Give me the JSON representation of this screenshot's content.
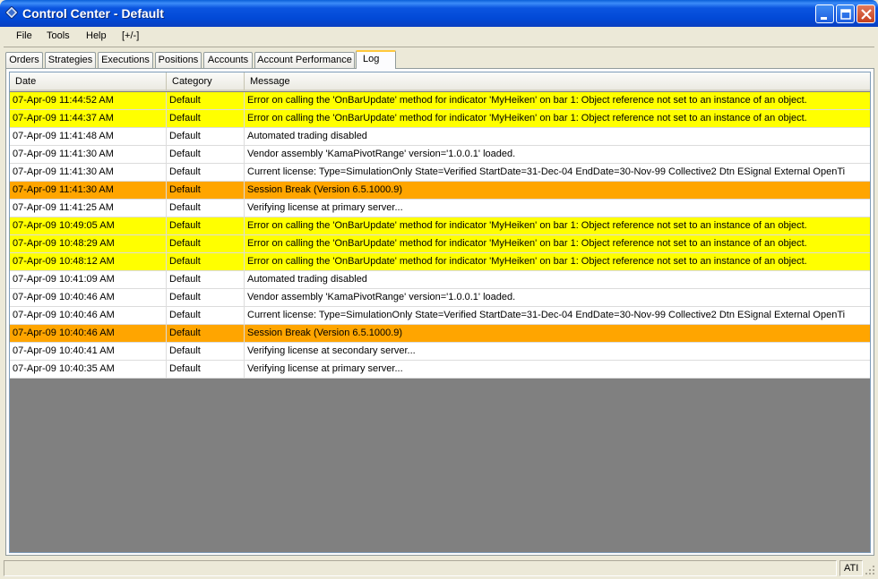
{
  "window": {
    "title": "Control Center - Default"
  },
  "menu": [
    "File",
    "Tools",
    "Help",
    "[+/-]"
  ],
  "tabs": [
    "Orders",
    "Strategies",
    "Executions",
    "Positions",
    "Accounts",
    "Account Performance",
    "Log"
  ],
  "active_tab": "Log",
  "grid": {
    "columns": [
      "Date",
      "Category",
      "Message"
    ],
    "colors": {
      "error": "#ffff00",
      "session": "#ffa500",
      "normal": "#ffffff",
      "empty": "#808080"
    },
    "rows": [
      {
        "date": "07-Apr-09 11:44:52 AM",
        "category": "Default",
        "message": "Error on calling the 'OnBarUpdate' method for indicator 'MyHeiken' on bar 1: Object reference not set to an instance of an object.",
        "type": "error"
      },
      {
        "date": "07-Apr-09 11:44:37 AM",
        "category": "Default",
        "message": "Error on calling the 'OnBarUpdate' method for indicator 'MyHeiken' on bar 1: Object reference not set to an instance of an object.",
        "type": "error"
      },
      {
        "date": "07-Apr-09 11:41:48 AM",
        "category": "Default",
        "message": "Automated trading disabled",
        "type": "normal"
      },
      {
        "date": "07-Apr-09 11:41:30 AM",
        "category": "Default",
        "message": "Vendor assembly 'KamaPivotRange' version='1.0.0.1' loaded.",
        "type": "normal"
      },
      {
        "date": "07-Apr-09 11:41:30 AM",
        "category": "Default",
        "message": "Current license: Type=SimulationOnly State=Verified StartDate=31-Dec-04 EndDate=30-Nov-99 Collective2 Dtn ESignal External OpenTi",
        "type": "normal"
      },
      {
        "date": "07-Apr-09 11:41:30 AM",
        "category": "Default",
        "message": "Session Break (Version 6.5.1000.9)",
        "type": "session"
      },
      {
        "date": "07-Apr-09 11:41:25 AM",
        "category": "Default",
        "message": "Verifying license at primary server...",
        "type": "normal"
      },
      {
        "date": "07-Apr-09 10:49:05 AM",
        "category": "Default",
        "message": "Error on calling the 'OnBarUpdate' method for indicator 'MyHeiken' on bar 1: Object reference not set to an instance of an object.",
        "type": "error"
      },
      {
        "date": "07-Apr-09 10:48:29 AM",
        "category": "Default",
        "message": "Error on calling the 'OnBarUpdate' method for indicator 'MyHeiken' on bar 1: Object reference not set to an instance of an object.",
        "type": "error"
      },
      {
        "date": "07-Apr-09 10:48:12 AM",
        "category": "Default",
        "message": "Error on calling the 'OnBarUpdate' method for indicator 'MyHeiken' on bar 1: Object reference not set to an instance of an object.",
        "type": "error"
      },
      {
        "date": "07-Apr-09 10:41:09 AM",
        "category": "Default",
        "message": "Automated trading disabled",
        "type": "normal"
      },
      {
        "date": "07-Apr-09 10:40:46 AM",
        "category": "Default",
        "message": "Vendor assembly 'KamaPivotRange' version='1.0.0.1' loaded.",
        "type": "normal"
      },
      {
        "date": "07-Apr-09 10:40:46 AM",
        "category": "Default",
        "message": "Current license: Type=SimulationOnly State=Verified StartDate=31-Dec-04 EndDate=30-Nov-99 Collective2 Dtn ESignal External OpenTi",
        "type": "normal"
      },
      {
        "date": "07-Apr-09 10:40:46 AM",
        "category": "Default",
        "message": "Session Break (Version 6.5.1000.9)",
        "type": "session"
      },
      {
        "date": "07-Apr-09 10:40:41 AM",
        "category": "Default",
        "message": "Verifying license at secondary server...",
        "type": "normal"
      },
      {
        "date": "07-Apr-09 10:40:35 AM",
        "category": "Default",
        "message": "Verifying license at primary server...",
        "type": "normal"
      }
    ]
  },
  "statusbar": {
    "connection": "ATI"
  }
}
